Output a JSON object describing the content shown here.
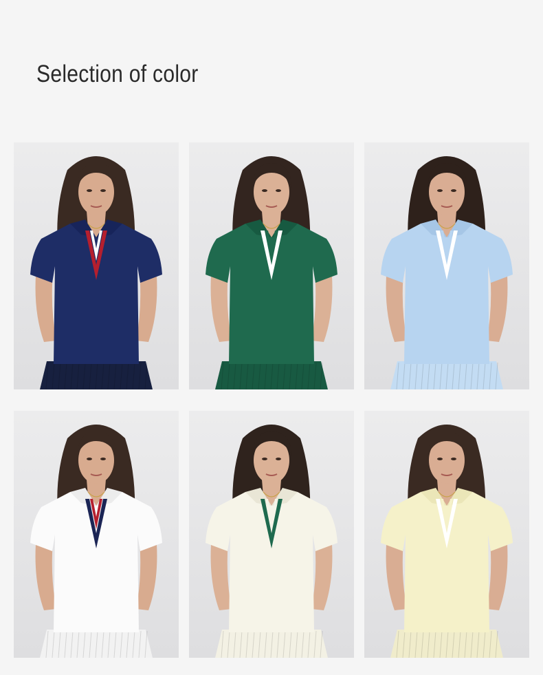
{
  "page": {
    "title": "Selection of color"
  },
  "colors": {
    "background": "#f5f5f5",
    "photo_backdrop": "#e6e6e7",
    "accent_red": "#b51f2e",
    "accent_white": "#ffffff",
    "accent_navy": "#1b2555",
    "accent_green": "#1f6a4e"
  },
  "swatches": [
    {
      "color": "navy",
      "shirt": "#1e2d66",
      "collar_shade": "#17245a",
      "stripe_outer": "#b51f2e",
      "stripe_inner": "#ffffff",
      "skirt": "#17203f",
      "hair": "#3a2a22",
      "skin": "#d8ab8f"
    },
    {
      "color": "green",
      "shirt": "#1f6a4e",
      "collar_shade": "#175a41",
      "stripe_outer": "#ffffff",
      "stripe_inner": "#1f6a4e",
      "skirt": "#185a42",
      "hair": "#33251f",
      "skin": "#dbb196"
    },
    {
      "color": "light-blue",
      "shirt": "#b7d4f0",
      "collar_shade": "#a6c6e6",
      "stripe_outer": "#ffffff",
      "stripe_inner": "#b7d4f0",
      "skirt": "#c3dcf3",
      "hair": "#2e211b",
      "skin": "#d9ad93"
    },
    {
      "color": "white",
      "shirt": "#fbfbfb",
      "collar_shade": "#ececec",
      "stripe_outer": "#1b2555",
      "stripe_inner": "#b51f2e",
      "skirt": "#f2f2f2",
      "hair": "#3a2a22",
      "skin": "#d8ab8f"
    },
    {
      "color": "cream",
      "shirt": "#f6f4e8",
      "collar_shade": "#e9e6d6",
      "stripe_outer": "#1f6a4e",
      "stripe_inner": "#f6f4e8",
      "skirt": "#f3f1e4",
      "hair": "#2f231d",
      "skin": "#dbb196"
    },
    {
      "color": "pale-yellow",
      "shirt": "#f5f1c9",
      "collar_shade": "#ebe6b8",
      "stripe_outer": "#ffffff",
      "stripe_inner": "#f5f1c9",
      "skirt": "#f0eccb",
      "hair": "#3a2a22",
      "skin": "#d9ad93"
    }
  ]
}
